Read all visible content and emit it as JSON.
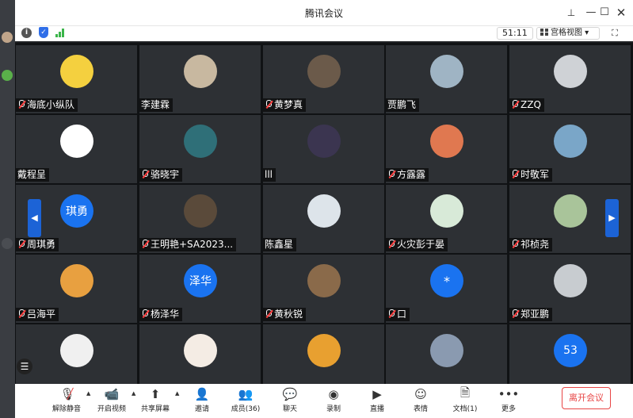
{
  "window": {
    "title": "腾讯会议"
  },
  "toolbar": {
    "timer": "51:11",
    "view_label": "宫格视图"
  },
  "participants": [
    {
      "name": "海底小纵队",
      "muted": true,
      "avatar_color": "#f4d03f",
      "avatar_text": "",
      "icon": "minion-avatar"
    },
    {
      "name": "李建霖",
      "muted": false,
      "avatar_color": "#c8b8a0",
      "avatar_text": "",
      "icon": "person-photo-avatar"
    },
    {
      "name": "黄梦真",
      "muted": true,
      "avatar_color": "#6b5a4a",
      "avatar_text": "",
      "icon": "cat-photo-avatar"
    },
    {
      "name": "贾鹏飞",
      "muted": false,
      "avatar_color": "#9fb4c4",
      "avatar_text": "",
      "icon": "landscape-avatar"
    },
    {
      "name": "ZZQ",
      "muted": true,
      "avatar_color": "#cfd2d6",
      "avatar_text": "",
      "icon": "default-user-avatar"
    },
    {
      "name": "戴程呈",
      "muted": false,
      "avatar_color": "#ffffff",
      "avatar_text": "",
      "icon": "cartoon-person-avatar"
    },
    {
      "name": "骆晓宇",
      "muted": true,
      "avatar_color": "#2f6f78",
      "avatar_text": "",
      "icon": "snowflake-avatar"
    },
    {
      "name": "lll",
      "muted": false,
      "avatar_color": "#3b3550",
      "avatar_text": "",
      "icon": "night-scene-avatar"
    },
    {
      "name": "方露露",
      "muted": true,
      "avatar_color": "#e07850",
      "avatar_text": "",
      "icon": "flower-avatar"
    },
    {
      "name": "时敬军",
      "muted": true,
      "avatar_color": "#7aa6c8",
      "avatar_text": "",
      "icon": "beach-avatar"
    },
    {
      "name": "周琪勇",
      "muted": true,
      "avatar_color": "#1a73f0",
      "avatar_text": "琪勇",
      "icon": "initials-avatar"
    },
    {
      "name": "王明艳+SA2023...",
      "muted": true,
      "avatar_color": "#5a4a3a",
      "avatar_text": "",
      "icon": "room-photo-avatar"
    },
    {
      "name": "陈鑫星",
      "muted": false,
      "avatar_color": "#dde4ea",
      "avatar_text": "",
      "icon": "sketch-avatar"
    },
    {
      "name": "火灾彭于晏",
      "muted": true,
      "avatar_color": "#d8ead8",
      "avatar_text": "",
      "icon": "dino-avatar"
    },
    {
      "name": "祁桢尧",
      "muted": true,
      "avatar_color": "#a9c49a",
      "avatar_text": "",
      "icon": "forest-avatar"
    },
    {
      "name": "吕海平",
      "muted": true,
      "avatar_color": "#e8a040",
      "avatar_text": "",
      "icon": "anime-avatar"
    },
    {
      "name": "杨泽华",
      "muted": true,
      "avatar_color": "#1a73f0",
      "avatar_text": "泽华",
      "icon": "initials-avatar"
    },
    {
      "name": "黄秋锐",
      "muted": true,
      "avatar_color": "#8a6a4a",
      "avatar_text": "",
      "icon": "cat-avatar"
    },
    {
      "name": "口",
      "muted": true,
      "avatar_color": "#1a73f0",
      "avatar_text": "*",
      "icon": "initials-avatar"
    },
    {
      "name": "郑亚鹏",
      "muted": true,
      "avatar_color": "#c8ccd0",
      "avatar_text": "",
      "icon": "sketch-avatar"
    },
    {
      "name": "",
      "muted": false,
      "avatar_color": "#f0f0f0",
      "avatar_text": "",
      "icon": "anime-person-avatar"
    },
    {
      "name": "",
      "muted": false,
      "avatar_color": "#f4ece4",
      "avatar_text": "",
      "icon": "drawn-person-avatar"
    },
    {
      "name": "",
      "muted": false,
      "avatar_color": "#e8a030",
      "avatar_text": "",
      "icon": "anime-avatar"
    },
    {
      "name": "",
      "muted": false,
      "avatar_color": "#8a9ab0",
      "avatar_text": "",
      "icon": "anime-avatar"
    },
    {
      "name": "",
      "muted": false,
      "avatar_color": "#1a73f0",
      "avatar_text": "53",
      "icon": "initials-avatar"
    }
  ],
  "controls": {
    "unmute": "解除静音",
    "video": "开启视频",
    "share": "共享屏幕",
    "invite": "邀请",
    "members": "成员(36)",
    "chat": "聊天",
    "record": "录制",
    "live": "直播",
    "reactions": "表情",
    "docs": "文档(1)",
    "more": "更多",
    "leave": "离开会议"
  },
  "colors": {
    "accent": "#1a73f0",
    "danger": "#e84545",
    "tile": "#2d3034"
  }
}
